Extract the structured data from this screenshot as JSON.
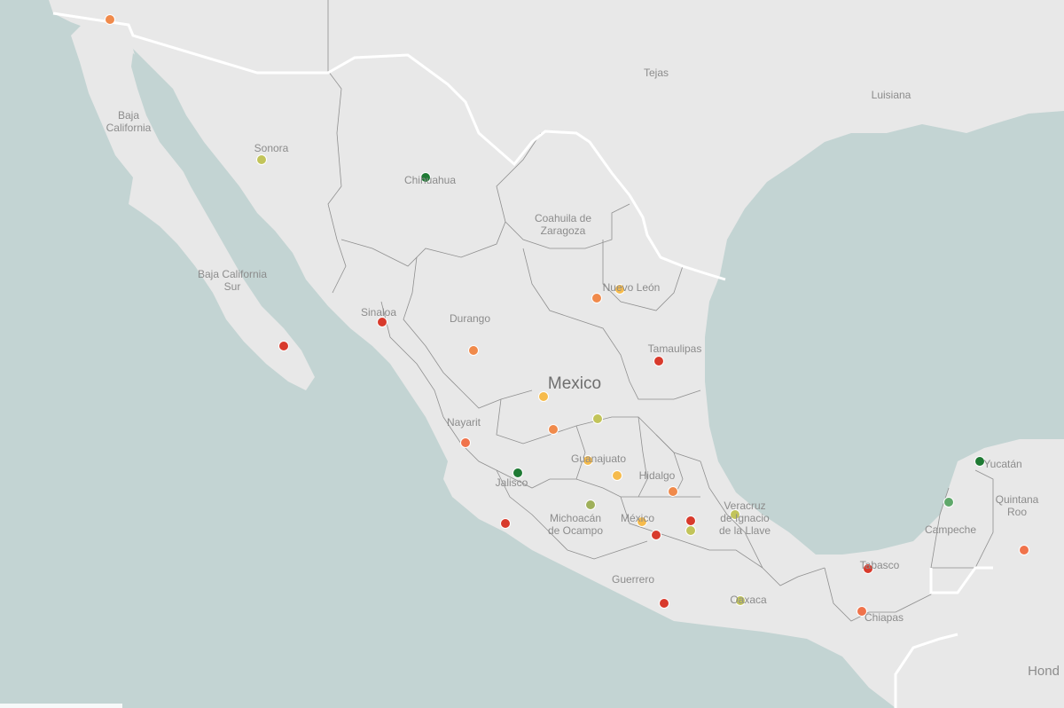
{
  "colors": {
    "ocean": "#c3d4d3",
    "land": "#e8e8e8",
    "state_border": "#8f8f8f",
    "country_border": "#ffffff",
    "label": "#8c8c8c"
  },
  "labels": {
    "baja_california": "Baja\nCalifornia",
    "sonora": "Sonora",
    "chihuahua": "Chihuahua",
    "tejas": "Tejas",
    "luisiana": "Luisiana",
    "coahuila": "Coahuila de\nZaragoza",
    "nuevo_leon": "Nuevo León",
    "baja_california_sur": "Baja California\nSur",
    "sinaloa": "Sinaloa",
    "durango": "Durango",
    "tamaulipas": "Tamaulipas",
    "mexico_country": "Mexico",
    "nayarit": "Nayarit",
    "guanajuato": "Guanajuato",
    "jalisco": "Jalisco",
    "hidalgo": "Hidalgo",
    "michoacan": "Michoacán\nde Ocampo",
    "mexico_state": "México",
    "veracruz": "Veracruz\nde Ignacio\nde la Llave",
    "guerrero": "Guerrero",
    "oaxaca": "Oaxaca",
    "tabasco": "Tabasco",
    "chiapas": "Chiapas",
    "campeche": "Campeche",
    "yucatan": "Yucatán",
    "quintana_roo": "Quintana\nRoo",
    "honduras": "Hond"
  },
  "points": [
    {
      "name": "point-baja-california",
      "color": "#f08a4b"
    },
    {
      "name": "point-sonora",
      "color": "#c2c45a"
    },
    {
      "name": "point-chihuahua",
      "color": "#1f7a34"
    },
    {
      "name": "point-coahuila",
      "color": "#f08a4b"
    },
    {
      "name": "point-nuevo-leon",
      "color": "#f6bb4c"
    },
    {
      "name": "point-baja-california-sur",
      "color": "#d83a2c"
    },
    {
      "name": "point-sinaloa",
      "color": "#d83a2c"
    },
    {
      "name": "point-durango",
      "color": "#f08a4b"
    },
    {
      "name": "point-tamaulipas",
      "color": "#d83a2c"
    },
    {
      "name": "point-zacatecas",
      "color": "#f6bb4c"
    },
    {
      "name": "point-san-luis-potosi",
      "color": "#c2c45a"
    },
    {
      "name": "point-aguascalientes",
      "color": "#f08a4b"
    },
    {
      "name": "point-nayarit",
      "color": "#f0734b"
    },
    {
      "name": "point-jalisco",
      "color": "#1f7a34"
    },
    {
      "name": "point-guanajuato",
      "color": "#f6bb4c"
    },
    {
      "name": "point-queretaro",
      "color": "#f6bb4c"
    },
    {
      "name": "point-hidalgo",
      "color": "#f08a4b"
    },
    {
      "name": "point-michoacan",
      "color": "#9fb05a"
    },
    {
      "name": "point-colima",
      "color": "#d83a2c"
    },
    {
      "name": "point-mexico-state",
      "color": "#f6bb4c"
    },
    {
      "name": "point-morelos",
      "color": "#d83a2c"
    },
    {
      "name": "point-puebla-north",
      "color": "#d83a2c"
    },
    {
      "name": "point-puebla",
      "color": "#c2c45a"
    },
    {
      "name": "point-veracruz",
      "color": "#c2c45a"
    },
    {
      "name": "point-guerrero",
      "color": "#d83a2c"
    },
    {
      "name": "point-oaxaca",
      "color": "#c2c45a"
    },
    {
      "name": "point-tabasco",
      "color": "#d83a2c"
    },
    {
      "name": "point-chiapas",
      "color": "#f0734b"
    },
    {
      "name": "point-campeche",
      "color": "#5fa86a"
    },
    {
      "name": "point-yucatan",
      "color": "#1f7a34"
    },
    {
      "name": "point-quintana-roo",
      "color": "#f0734b"
    }
  ]
}
